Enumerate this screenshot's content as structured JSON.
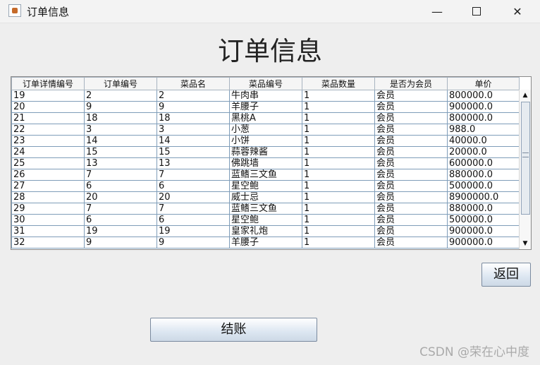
{
  "window": {
    "title": "订单信息",
    "minimize_icon": "minimize-icon",
    "maximize_icon": "maximize-icon",
    "close_icon": "close-icon"
  },
  "page": {
    "heading": "订单信息"
  },
  "table": {
    "columns": [
      "订单详情编号",
      "订单编号",
      "菜品名",
      "菜品编号",
      "菜品数量",
      "是否为会员",
      "单价"
    ],
    "rows": [
      [
        "19",
        "2",
        "2",
        "牛肉串",
        "1",
        "会员",
        "800000.0"
      ],
      [
        "20",
        "9",
        "9",
        "羊腰子",
        "1",
        "会员",
        "900000.0"
      ],
      [
        "21",
        "18",
        "18",
        "黑桃A",
        "1",
        "会员",
        "800000.0"
      ],
      [
        "22",
        "3",
        "3",
        "小葱",
        "1",
        "会员",
        "988.0"
      ],
      [
        "23",
        "14",
        "14",
        "小饼",
        "1",
        "会员",
        "40000.0"
      ],
      [
        "24",
        "15",
        "15",
        "蒜蓉辣酱",
        "1",
        "会员",
        "20000.0"
      ],
      [
        "25",
        "13",
        "13",
        "佛跳墙",
        "1",
        "会员",
        "600000.0"
      ],
      [
        "26",
        "7",
        "7",
        "蓝鳍三文鱼",
        "1",
        "会员",
        "880000.0"
      ],
      [
        "27",
        "6",
        "6",
        "星空鲍",
        "1",
        "会员",
        "500000.0"
      ],
      [
        "28",
        "20",
        "20",
        "威士忌",
        "1",
        "会员",
        "8900000.0"
      ],
      [
        "29",
        "7",
        "7",
        "蓝鳍三文鱼",
        "1",
        "会员",
        "880000.0"
      ],
      [
        "30",
        "6",
        "6",
        "星空鲍",
        "1",
        "会员",
        "500000.0"
      ],
      [
        "31",
        "19",
        "19",
        "皇家礼炮",
        "1",
        "会员",
        "900000.0"
      ],
      [
        "32",
        "9",
        "9",
        "羊腰子",
        "1",
        "会员",
        "900000.0"
      ]
    ]
  },
  "buttons": {
    "back": "返回",
    "checkout": "结账"
  },
  "watermark": "CSDN @荣在心中度"
}
